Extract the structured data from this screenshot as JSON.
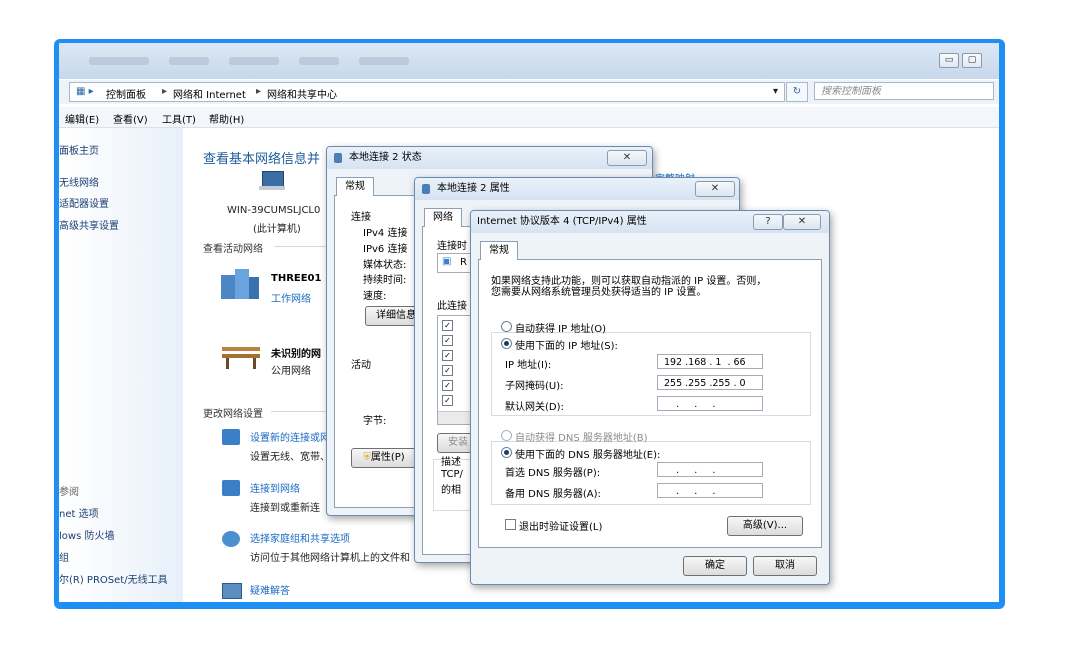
{
  "explorer": {
    "breadcrumb": [
      "控制面板",
      "网络和 Internet",
      "网络和共享中心"
    ],
    "search_placeholder": "搜索控制面板",
    "menu": [
      "编辑(E)",
      "查看(V)",
      "工具(T)",
      "帮助(H)"
    ]
  },
  "left_pane": {
    "top_links": [
      "面板主页",
      "无线网络",
      "适配器设置",
      "高级共享设置"
    ],
    "see_also": "参阅",
    "bottom_links": [
      "net 选项",
      "lows 防火墙",
      "组",
      "尔(R) PROSet/无线工具"
    ]
  },
  "main": {
    "title": "查看基本网络信息并",
    "computer_name": "WIN-39CUMSLJCL0",
    "computer_sub": "(此计算机)",
    "active_networks_header": "查看活动网络",
    "network1": {
      "name": "THREE01",
      "type": "工作网络"
    },
    "network2": {
      "name": "未识别的网",
      "type": "公用网络"
    },
    "change_settings_header": "更改网络设置",
    "items": [
      {
        "link": "设置新的连接或网",
        "desc": "设置无线、宽带、"
      },
      {
        "link": "连接到网络",
        "desc": "连接到或重新连"
      },
      {
        "link": "选择家庭组和共享选项",
        "desc": "访问位于其他网络计算机上的文件和"
      },
      {
        "link": "疑难解答",
        "desc": ""
      }
    ],
    "top_right_link": "完整映射"
  },
  "status_dialog": {
    "title": "本地连接 2 状态",
    "tab": "常规",
    "section_connection": "连接",
    "rows": [
      "IPv4 连接",
      "IPv6 连接",
      "媒体状态:",
      "持续时间:",
      "速度:"
    ],
    "details_button": "详细信息",
    "section_activity": "活动",
    "bytes_label": "字节:",
    "properties_button": "属性(P)"
  },
  "props_dialog": {
    "title": "本地连接 2 属性",
    "tab": "网络",
    "connect_using": "连接时",
    "adapter_prefix": "R",
    "items_label": "此连接",
    "install_button": "安装",
    "description_label": "描述",
    "description_text": "TCP/",
    "description_text2": "的相"
  },
  "ipv4_dialog": {
    "title": "Internet 协议版本 4 (TCP/IPv4) 属性",
    "help": "?",
    "tab": "常规",
    "intro_line1": "如果网络支持此功能，则可以获取自动指派的 IP 设置。否则，",
    "intro_line2": "您需要从网络系统管理员处获得适当的 IP 设置。",
    "auto_ip": "自动获得 IP 地址(O)",
    "manual_ip": "使用下面的 IP 地址(S):",
    "ip_label": "IP 地址(I):",
    "ip_value": "192 .168 . 1  . 66",
    "mask_label": "子网掩码(U):",
    "mask_value": "255 .255 .255 . 0",
    "gateway_label": "默认网关(D):",
    "gateway_value": "    .     .     .",
    "auto_dns": "自动获得 DNS 服务器地址(B)",
    "manual_dns": "使用下面的 DNS 服务器地址(E):",
    "dns1_label": "首选 DNS 服务器(P):",
    "dns1_value": "    .     .     .",
    "dns2_label": "备用 DNS 服务器(A):",
    "dns2_value": "    .     .     .",
    "validate": "退出时验证设置(L)",
    "advanced_button": "高级(V)...",
    "ok_button": "确定",
    "cancel_button": "取消"
  },
  "colors": {
    "frame": "#1e90f5",
    "link": "#1a6ac4",
    "title": "#1e5b9c"
  }
}
